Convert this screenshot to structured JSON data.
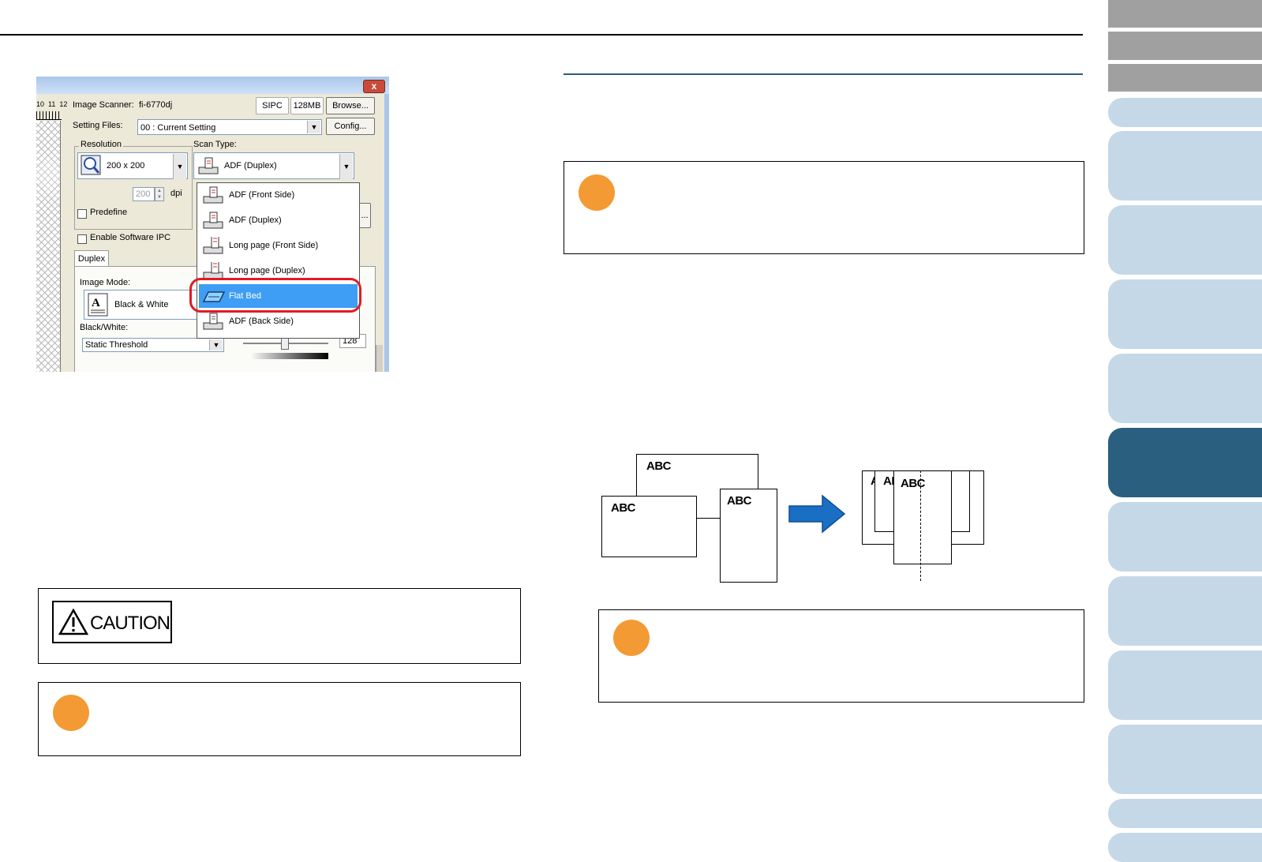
{
  "dialog": {
    "close_label": "x",
    "ruler_labels": "10  11  12",
    "scanner_label": "Image Scanner:",
    "scanner_value": "fi-6770dj",
    "sipc_label": "SIPC",
    "memory_label": "128MB",
    "browse_label": "Browse...",
    "setting_files_label": "Setting Files:",
    "setting_files_value": "00 : Current Setting",
    "config_label": "Config...",
    "resolution_label": "Resolution",
    "resolution_value": "200 x 200",
    "custom_res_value": "200",
    "dpi_label": "dpi",
    "predefine_label": "Predefine",
    "scan_type_label": "Scan Type:",
    "scan_type_value": "ADF (Duplex)",
    "software_ipc_label": "Enable Software IPC",
    "duplex_tab_label": "Duplex",
    "image_mode_label": "Image Mode:",
    "image_mode_value": "Black & White",
    "black_white_label": "Black/White:",
    "black_white_value": "Static Threshold",
    "threshold_value": "128",
    "more_button_label": "...",
    "scan_type_options": [
      {
        "label": "ADF (Front Side)",
        "icon": "adf-front-icon"
      },
      {
        "label": "ADF (Duplex)",
        "icon": "adf-duplex-icon"
      },
      {
        "label": "Long page (Front Side)",
        "icon": "long-page-front-icon"
      },
      {
        "label": "Long page (Duplex)",
        "icon": "long-page-duplex-icon"
      },
      {
        "label": "Flat Bed",
        "icon": "flatbed-icon"
      },
      {
        "label": "ADF (Back Side)",
        "icon": "adf-back-icon"
      }
    ],
    "selected_option": "Flat Bed",
    "highlight_color": "#3e9df4",
    "callout_color": "#e01b24"
  },
  "caution": {
    "label": "CAUTION"
  },
  "diagram": {
    "abc_top": "ABC",
    "abc_left": "ABC",
    "abc_right": "ABC",
    "stack_label_1": "A",
    "stack_label_2": "AI",
    "stack_label_3": "ABC",
    "arrow_color": "#1a6fc4"
  },
  "colors": {
    "tab_gray": "#a0a0a0",
    "tab_light": "#c5d8e8",
    "tab_active": "#2a5f80",
    "note_dot": "#f39a34"
  }
}
